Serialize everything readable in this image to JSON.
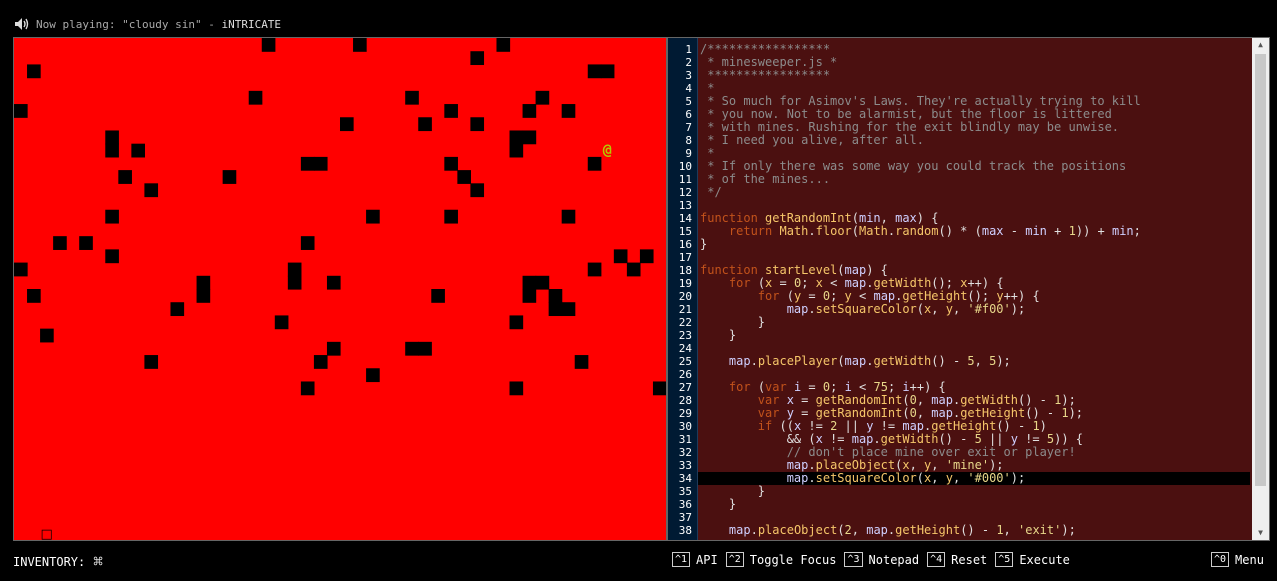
{
  "header": {
    "now_playing_prefix": "Now playing: ",
    "track": "\"cloudy sin\"",
    "separator": " - ",
    "artist": "iNTRICATE"
  },
  "game": {
    "floor_color": "#ff0000",
    "mine_color": "#000000",
    "player_glyph": "@",
    "player_color": "#b5c900",
    "exit_glyph": "□",
    "grid": {
      "cols": 50,
      "rows": 38,
      "black_cells": [
        [
          19,
          0
        ],
        [
          26,
          0
        ],
        [
          37,
          0
        ],
        [
          35,
          1
        ],
        [
          1,
          2
        ],
        [
          44,
          2
        ],
        [
          45,
          2
        ],
        [
          18,
          4
        ],
        [
          30,
          4
        ],
        [
          40,
          4
        ],
        [
          0,
          5
        ],
        [
          33,
          5
        ],
        [
          39,
          5
        ],
        [
          42,
          5
        ],
        [
          25,
          6
        ],
        [
          31,
          6
        ],
        [
          35,
          6
        ],
        [
          7,
          7
        ],
        [
          38,
          7
        ],
        [
          39,
          7
        ],
        [
          7,
          8
        ],
        [
          9,
          8
        ],
        [
          38,
          8
        ],
        [
          22,
          9
        ],
        [
          23,
          9
        ],
        [
          33,
          9
        ],
        [
          44,
          9
        ],
        [
          8,
          10
        ],
        [
          16,
          10
        ],
        [
          34,
          10
        ],
        [
          10,
          11
        ],
        [
          35,
          11
        ],
        [
          7,
          13
        ],
        [
          27,
          13
        ],
        [
          33,
          13
        ],
        [
          42,
          13
        ],
        [
          3,
          15
        ],
        [
          5,
          15
        ],
        [
          22,
          15
        ],
        [
          7,
          16
        ],
        [
          46,
          16
        ],
        [
          48,
          16
        ],
        [
          0,
          17
        ],
        [
          21,
          17
        ],
        [
          44,
          17
        ],
        [
          47,
          17
        ],
        [
          14,
          18
        ],
        [
          21,
          18
        ],
        [
          24,
          18
        ],
        [
          39,
          18
        ],
        [
          40,
          18
        ],
        [
          1,
          19
        ],
        [
          14,
          19
        ],
        [
          32,
          19
        ],
        [
          39,
          19
        ],
        [
          41,
          19
        ],
        [
          12,
          20
        ],
        [
          41,
          20
        ],
        [
          42,
          20
        ],
        [
          20,
          21
        ],
        [
          38,
          21
        ],
        [
          2,
          22
        ],
        [
          24,
          23
        ],
        [
          30,
          23
        ],
        [
          31,
          23
        ],
        [
          10,
          24
        ],
        [
          23,
          24
        ],
        [
          43,
          24
        ],
        [
          27,
          25
        ],
        [
          22,
          26
        ],
        [
          38,
          26
        ],
        [
          49,
          26
        ]
      ],
      "player": [
        45,
        8
      ],
      "exit": [
        2,
        37
      ]
    }
  },
  "editor": {
    "lines": [
      [
        [
          "c",
          "/*****************"
        ]
      ],
      [
        [
          "c",
          " * minesweeper.js *"
        ]
      ],
      [
        [
          "c",
          " *****************"
        ]
      ],
      [
        [
          "c",
          " *"
        ]
      ],
      [
        [
          "c",
          " * So much for Asimov's Laws. They're actually trying to kill"
        ]
      ],
      [
        [
          "c",
          " * you now. Not to be alarmist, but the floor is littered"
        ]
      ],
      [
        [
          "c",
          " * with mines. Rushing for the exit blindly may be unwise."
        ]
      ],
      [
        [
          "c",
          " * I need you alive, after all."
        ]
      ],
      [
        [
          "c",
          " *"
        ]
      ],
      [
        [
          "c",
          " * If only there was some way you could track the positions"
        ]
      ],
      [
        [
          "c",
          " * of the mines..."
        ]
      ],
      [
        [
          "c",
          " */"
        ]
      ],
      [],
      [
        [
          "k",
          "function"
        ],
        [
          "p",
          " "
        ],
        [
          "f",
          "getRandomInt"
        ],
        [
          "p",
          "("
        ],
        [
          "v",
          "min"
        ],
        [
          "p",
          ", "
        ],
        [
          "v",
          "max"
        ],
        [
          "p",
          ") {"
        ]
      ],
      [
        [
          "p",
          "    "
        ],
        [
          "k",
          "return"
        ],
        [
          "p",
          " "
        ],
        [
          "f",
          "Math"
        ],
        [
          "p",
          "."
        ],
        [
          "f",
          "floor"
        ],
        [
          "p",
          "("
        ],
        [
          "f",
          "Math"
        ],
        [
          "p",
          "."
        ],
        [
          "f",
          "random"
        ],
        [
          "p",
          "() * ("
        ],
        [
          "v",
          "max"
        ],
        [
          "p",
          " - "
        ],
        [
          "v",
          "min"
        ],
        [
          "p",
          " + "
        ],
        [
          "n",
          "1"
        ],
        [
          "p",
          ")) + "
        ],
        [
          "v",
          "min"
        ],
        [
          "p",
          ";"
        ]
      ],
      [
        [
          "p",
          "}"
        ]
      ],
      [],
      [
        [
          "k",
          "function"
        ],
        [
          "p",
          " "
        ],
        [
          "f",
          "startLevel"
        ],
        [
          "p",
          "("
        ],
        [
          "v",
          "map"
        ],
        [
          "p",
          ") {"
        ]
      ],
      [
        [
          "p",
          "    "
        ],
        [
          "k",
          "for"
        ],
        [
          "p",
          " ("
        ],
        [
          "f",
          "x"
        ],
        [
          "p",
          " = "
        ],
        [
          "n",
          "0"
        ],
        [
          "p",
          "; "
        ],
        [
          "f",
          "x"
        ],
        [
          "p",
          " < "
        ],
        [
          "v",
          "map"
        ],
        [
          "p",
          "."
        ],
        [
          "f",
          "getWidth"
        ],
        [
          "p",
          "(); "
        ],
        [
          "f",
          "x"
        ],
        [
          "p",
          "++) {"
        ]
      ],
      [
        [
          "p",
          "        "
        ],
        [
          "k",
          "for"
        ],
        [
          "p",
          " ("
        ],
        [
          "f",
          "y"
        ],
        [
          "p",
          " = "
        ],
        [
          "n",
          "0"
        ],
        [
          "p",
          "; "
        ],
        [
          "f",
          "y"
        ],
        [
          "p",
          " < "
        ],
        [
          "v",
          "map"
        ],
        [
          "p",
          "."
        ],
        [
          "f",
          "getHeight"
        ],
        [
          "p",
          "(); "
        ],
        [
          "f",
          "y"
        ],
        [
          "p",
          "++) {"
        ]
      ],
      [
        [
          "p",
          "            "
        ],
        [
          "v",
          "map"
        ],
        [
          "p",
          "."
        ],
        [
          "f",
          "setSquareColor"
        ],
        [
          "p",
          "("
        ],
        [
          "f",
          "x"
        ],
        [
          "p",
          ", "
        ],
        [
          "f",
          "y"
        ],
        [
          "p",
          ", "
        ],
        [
          "s",
          "'#f00'"
        ],
        [
          "p",
          ");"
        ]
      ],
      [
        [
          "p",
          "        }"
        ]
      ],
      [
        [
          "p",
          "    }"
        ]
      ],
      [],
      [
        [
          "p",
          "    "
        ],
        [
          "v",
          "map"
        ],
        [
          "p",
          "."
        ],
        [
          "f",
          "placePlayer"
        ],
        [
          "p",
          "("
        ],
        [
          "v",
          "map"
        ],
        [
          "p",
          "."
        ],
        [
          "f",
          "getWidth"
        ],
        [
          "p",
          "() - "
        ],
        [
          "n",
          "5"
        ],
        [
          "p",
          ", "
        ],
        [
          "n",
          "5"
        ],
        [
          "p",
          ");"
        ]
      ],
      [],
      [
        [
          "p",
          "    "
        ],
        [
          "k",
          "for"
        ],
        [
          "p",
          " ("
        ],
        [
          "k",
          "var"
        ],
        [
          "p",
          " "
        ],
        [
          "v",
          "i"
        ],
        [
          "p",
          " = "
        ],
        [
          "n",
          "0"
        ],
        [
          "p",
          "; "
        ],
        [
          "v",
          "i"
        ],
        [
          "p",
          " < "
        ],
        [
          "n",
          "75"
        ],
        [
          "p",
          "; "
        ],
        [
          "v",
          "i"
        ],
        [
          "p",
          "++) {"
        ]
      ],
      [
        [
          "p",
          "        "
        ],
        [
          "k",
          "var"
        ],
        [
          "p",
          " "
        ],
        [
          "v",
          "x"
        ],
        [
          "p",
          " = "
        ],
        [
          "f",
          "getRandomInt"
        ],
        [
          "p",
          "("
        ],
        [
          "n",
          "0"
        ],
        [
          "p",
          ", "
        ],
        [
          "v",
          "map"
        ],
        [
          "p",
          "."
        ],
        [
          "f",
          "getWidth"
        ],
        [
          "p",
          "() - "
        ],
        [
          "n",
          "1"
        ],
        [
          "p",
          ");"
        ]
      ],
      [
        [
          "p",
          "        "
        ],
        [
          "k",
          "var"
        ],
        [
          "p",
          " "
        ],
        [
          "v",
          "y"
        ],
        [
          "p",
          " = "
        ],
        [
          "f",
          "getRandomInt"
        ],
        [
          "p",
          "("
        ],
        [
          "n",
          "0"
        ],
        [
          "p",
          ", "
        ],
        [
          "v",
          "map"
        ],
        [
          "p",
          "."
        ],
        [
          "f",
          "getHeight"
        ],
        [
          "p",
          "() - "
        ],
        [
          "n",
          "1"
        ],
        [
          "p",
          ");"
        ]
      ],
      [
        [
          "p",
          "        "
        ],
        [
          "k",
          "if"
        ],
        [
          "p",
          " (("
        ],
        [
          "v",
          "x"
        ],
        [
          "p",
          " != "
        ],
        [
          "n",
          "2"
        ],
        [
          "p",
          " || "
        ],
        [
          "v",
          "y"
        ],
        [
          "p",
          " != "
        ],
        [
          "v",
          "map"
        ],
        [
          "p",
          "."
        ],
        [
          "f",
          "getHeight"
        ],
        [
          "p",
          "() - "
        ],
        [
          "n",
          "1"
        ],
        [
          "p",
          ")"
        ]
      ],
      [
        [
          "p",
          "            && ("
        ],
        [
          "v",
          "x"
        ],
        [
          "p",
          " != "
        ],
        [
          "v",
          "map"
        ],
        [
          "p",
          "."
        ],
        [
          "f",
          "getWidth"
        ],
        [
          "p",
          "() - "
        ],
        [
          "n",
          "5"
        ],
        [
          "p",
          " || "
        ],
        [
          "v",
          "y"
        ],
        [
          "p",
          " != "
        ],
        [
          "n",
          "5"
        ],
        [
          "p",
          ")) {"
        ]
      ],
      [
        [
          "p",
          "            "
        ],
        [
          "c",
          "// don't place mine over exit or player!"
        ]
      ],
      [
        [
          "p",
          "            "
        ],
        [
          "v",
          "map"
        ],
        [
          "p",
          "."
        ],
        [
          "f",
          "placeObject"
        ],
        [
          "p",
          "("
        ],
        [
          "f",
          "x"
        ],
        [
          "p",
          ", "
        ],
        [
          "f",
          "y"
        ],
        [
          "p",
          ", "
        ],
        [
          "s",
          "'mine'"
        ],
        [
          "p",
          ");"
        ]
      ],
      [
        [
          "p",
          "            "
        ],
        [
          "v",
          "map"
        ],
        [
          "p",
          "."
        ],
        [
          "f",
          "setSquareColor"
        ],
        [
          "p",
          "("
        ],
        [
          "f",
          "x"
        ],
        [
          "p",
          ", "
        ],
        [
          "f",
          "y"
        ],
        [
          "p",
          ", "
        ],
        [
          "s",
          "'#000'"
        ],
        [
          "p",
          ");"
        ]
      ],
      [
        [
          "p",
          "        }"
        ]
      ],
      [
        [
          "p",
          "    }"
        ]
      ],
      [],
      [
        [
          "p",
          "    "
        ],
        [
          "v",
          "map"
        ],
        [
          "p",
          "."
        ],
        [
          "f",
          "placeObject"
        ],
        [
          "p",
          "("
        ],
        [
          "n",
          "2"
        ],
        [
          "p",
          ", "
        ],
        [
          "v",
          "map"
        ],
        [
          "p",
          "."
        ],
        [
          "f",
          "getHeight"
        ],
        [
          "p",
          "() - "
        ],
        [
          "n",
          "1"
        ],
        [
          "p",
          ", "
        ],
        [
          "s",
          "'exit'"
        ],
        [
          "p",
          ");"
        ]
      ]
    ],
    "active_line": 34
  },
  "footer": {
    "inventory_label": "INVENTORY:",
    "inventory_icon": "⌘",
    "hotkeys": [
      {
        "key": "^1",
        "label": "API"
      },
      {
        "key": "^2",
        "label": "Toggle Focus"
      },
      {
        "key": "^3",
        "label": "Notepad"
      },
      {
        "key": "^4",
        "label": "Reset"
      },
      {
        "key": "^5",
        "label": "Execute"
      }
    ],
    "menu": {
      "key": "^0",
      "label": "Menu"
    }
  }
}
